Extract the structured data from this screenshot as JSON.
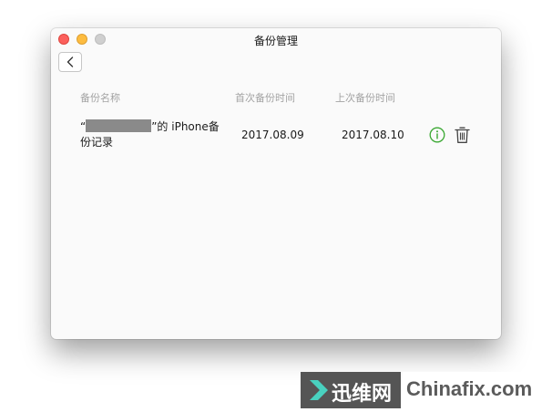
{
  "window": {
    "title": "备份管理"
  },
  "table": {
    "headers": {
      "name": "备份名称",
      "first_backup": "首次备份时间",
      "last_backup": "上次备份时间"
    },
    "rows": [
      {
        "name_prefix": "“",
        "name_suffix": "”的 iPhone备份记录",
        "first_backup": "2017.08.09",
        "last_backup": "2017.08.10"
      }
    ]
  },
  "icons": {
    "back": "chevron-left-icon",
    "info": "info-icon",
    "delete": "trash-icon"
  },
  "colors": {
    "info_green": "#3aa832",
    "close_light": "#fc605c",
    "minimize_light": "#fdbc40",
    "zoom_light": "#cfcfcf",
    "header_text": "#a3a3a3"
  },
  "watermark": {
    "cn": "迅维网",
    "en": "Chinafix.com"
  }
}
